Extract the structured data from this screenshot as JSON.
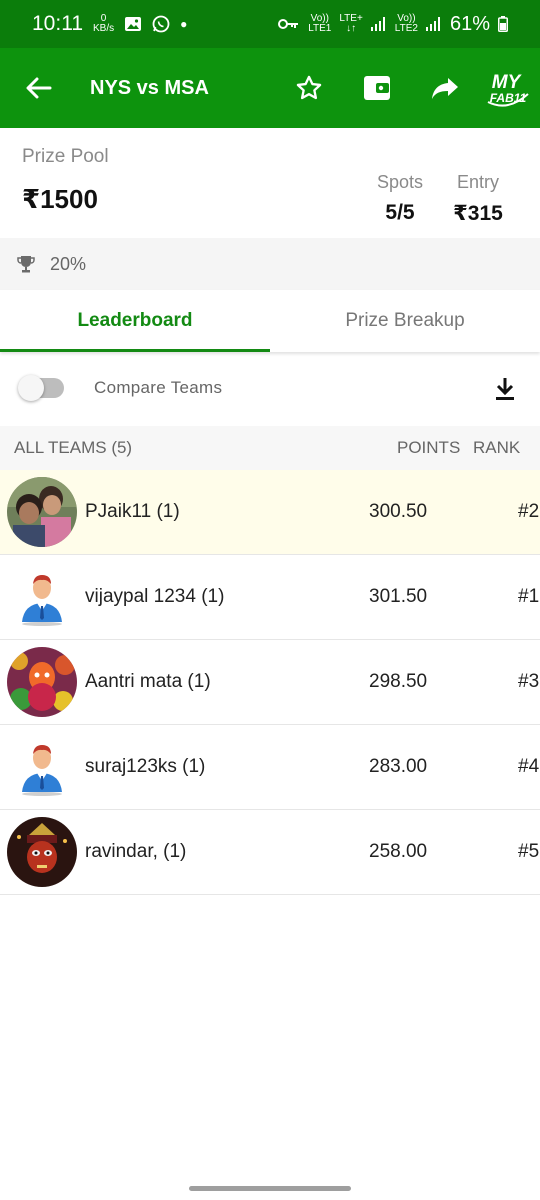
{
  "status_bar": {
    "time": "10:11",
    "net_speed_top": "0",
    "net_speed_bottom": "KB/s",
    "battery": "61%",
    "sim1_line1": "Vo))",
    "sim1_line2": "LTE1",
    "lte_label": "LTE+",
    "sim2_line1": "Vo))",
    "sim2_line2": "LTE2"
  },
  "appbar": {
    "title": "NYS vs MSA",
    "logo_text_top": "MY",
    "logo_text_bottom": "FAB11",
    "color": "#0d930d"
  },
  "contest": {
    "prize_pool_label": "Prize Pool",
    "prize_pool_value": "₹1500",
    "spots_label": "Spots",
    "spots_value": "5/5",
    "entry_label": "Entry",
    "entry_value": "₹315",
    "winners_percent": "20%"
  },
  "tabs": [
    {
      "label": "Leaderboard",
      "active": true
    },
    {
      "label": "Prize Breakup",
      "active": false
    }
  ],
  "compare": {
    "label": "Compare Teams",
    "enabled": false
  },
  "list_header": {
    "all_teams": "ALL TEAMS (5)",
    "points": "POINTS",
    "rank": "RANK"
  },
  "teams": [
    {
      "name": "PJaik11 (1)",
      "points": "300.50",
      "rank": "#2",
      "avatar": "photo-couple",
      "highlight": true
    },
    {
      "name": "vijaypal 1234 (1)",
      "points": "301.50",
      "rank": "#1",
      "avatar": "default-user-icon",
      "highlight": false
    },
    {
      "name": "Aantri mata (1)",
      "points": "298.50",
      "rank": "#3",
      "avatar": "photo-deity-colorful",
      "highlight": false
    },
    {
      "name": "suraj123ks (1)",
      "points": "283.00",
      "rank": "#4",
      "avatar": "default-user-icon",
      "highlight": false
    },
    {
      "name": "ravindar, (1)",
      "points": "258.00",
      "rank": "#5",
      "avatar": "photo-deity-dark",
      "highlight": false
    }
  ]
}
